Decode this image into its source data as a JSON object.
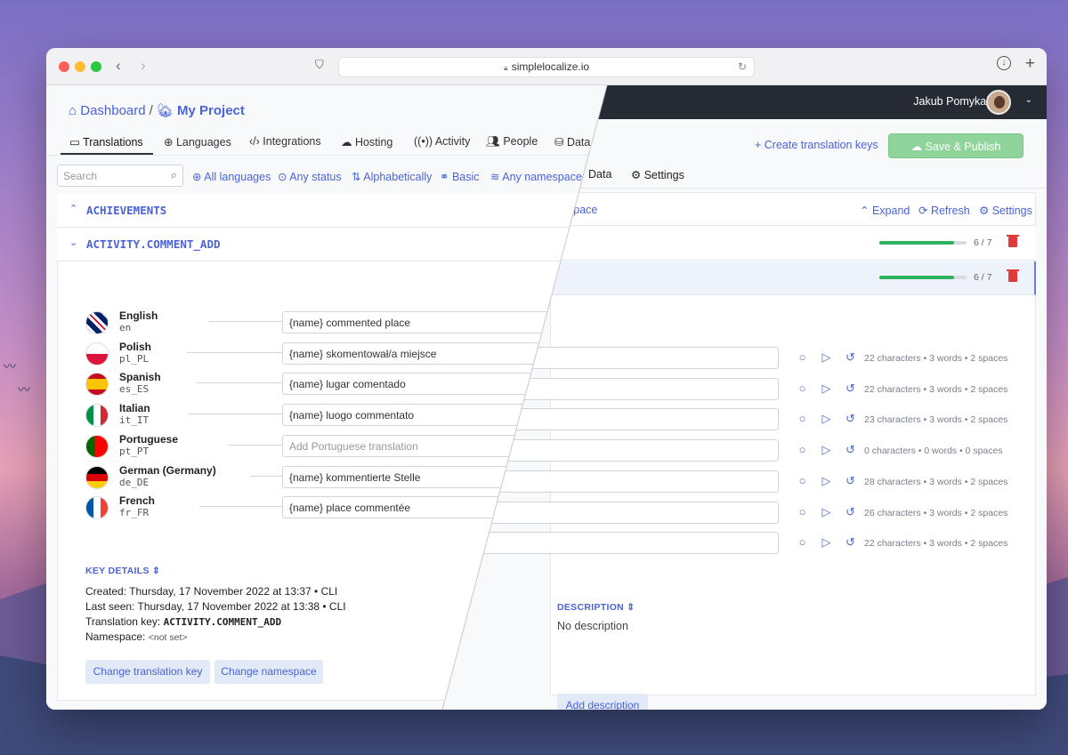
{
  "browser": {
    "url": "simplelocalize.io"
  },
  "breadcrumb": {
    "root": "Dashboard",
    "separator": "/",
    "project": "My Project"
  },
  "tabs": [
    {
      "label": "Translations"
    },
    {
      "label": "Languages"
    },
    {
      "label": "Integrations"
    },
    {
      "label": "Hosting"
    },
    {
      "label": "Activity"
    },
    {
      "label": "People"
    },
    {
      "label": "Data"
    }
  ],
  "right_tabs": {
    "data": "Data",
    "settings": "Settings"
  },
  "user": {
    "name": "Jakub Pomykała"
  },
  "actions": {
    "create_keys": "Create translation keys",
    "save_publish": "Save & Publish"
  },
  "search": {
    "placeholder": "Search"
  },
  "filters": {
    "languages": "All languages",
    "status": "Any status",
    "sort": "Alphabetically",
    "view": "Basic",
    "namespace": "Any namespace",
    "namespace_fragment": "space"
  },
  "toolbar": {
    "expand": "Expand",
    "refresh": "Refresh",
    "settings": "Settings"
  },
  "groups": [
    {
      "name": "ACHIEVEMENTS",
      "progress": "6 / 7",
      "progress_fraction": 0.857
    },
    {
      "name": "ACTIVITY.COMMENT_ADD",
      "progress": "6 / 7",
      "progress_fraction": 0.857
    }
  ],
  "languages": [
    {
      "name": "English",
      "code": "en",
      "value": "{name} commented place",
      "placeholder": "",
      "stats": "22 characters • 3 words • 2 spaces"
    },
    {
      "name": "Polish",
      "code": "pl_PL",
      "value": "{name} skomentował/a miejsce",
      "placeholder": "",
      "stats": "22 characters • 3 words • 2 spaces"
    },
    {
      "name": "Spanish",
      "code": "es_ES",
      "value": "{name} lugar comentado",
      "placeholder": "",
      "stats": "23 characters • 3 words • 2 spaces"
    },
    {
      "name": "Italian",
      "code": "it_IT",
      "value": "{name} luogo commentato",
      "placeholder": "",
      "stats": "0 characters • 0 words • 0 spaces"
    },
    {
      "name": "Portuguese",
      "code": "pt_PT",
      "value": "",
      "placeholder": "Add Portuguese translation",
      "stats": "28 characters • 3 words • 2 spaces"
    },
    {
      "name": "German (Germany)",
      "code": "de_DE",
      "value": "{name} kommentierte Stelle",
      "placeholder": "",
      "stats": "26 characters • 3 words • 2 spaces"
    },
    {
      "name": "French",
      "code": "fr_FR",
      "value": "{name} place commentée",
      "placeholder": "",
      "stats": "22 characters • 3 words • 2 spaces"
    }
  ],
  "key_details": {
    "heading": "KEY DETAILS",
    "created": "Created: Thursday, 17 November 2022 at 13:37 • CLI",
    "last_seen": "Last seen: Thursday, 17 November 2022 at 13:38 • CLI",
    "translation_key_label": "Translation key:",
    "translation_key": "ACTIVITY.COMMENT_ADD",
    "namespace_label": "Namespace:",
    "namespace_value": "<not set>",
    "change_key_button": "Change translation key",
    "change_namespace_button": "Change namespace"
  },
  "description": {
    "heading": "DESCRIPTION",
    "text": "No description",
    "add_button": "Add description"
  },
  "colors": {
    "accent": "#4a63d8",
    "topbar": "#262a33",
    "save_button": "#8fd49b",
    "progress": "#2db35d",
    "danger": "#e03a3a"
  }
}
